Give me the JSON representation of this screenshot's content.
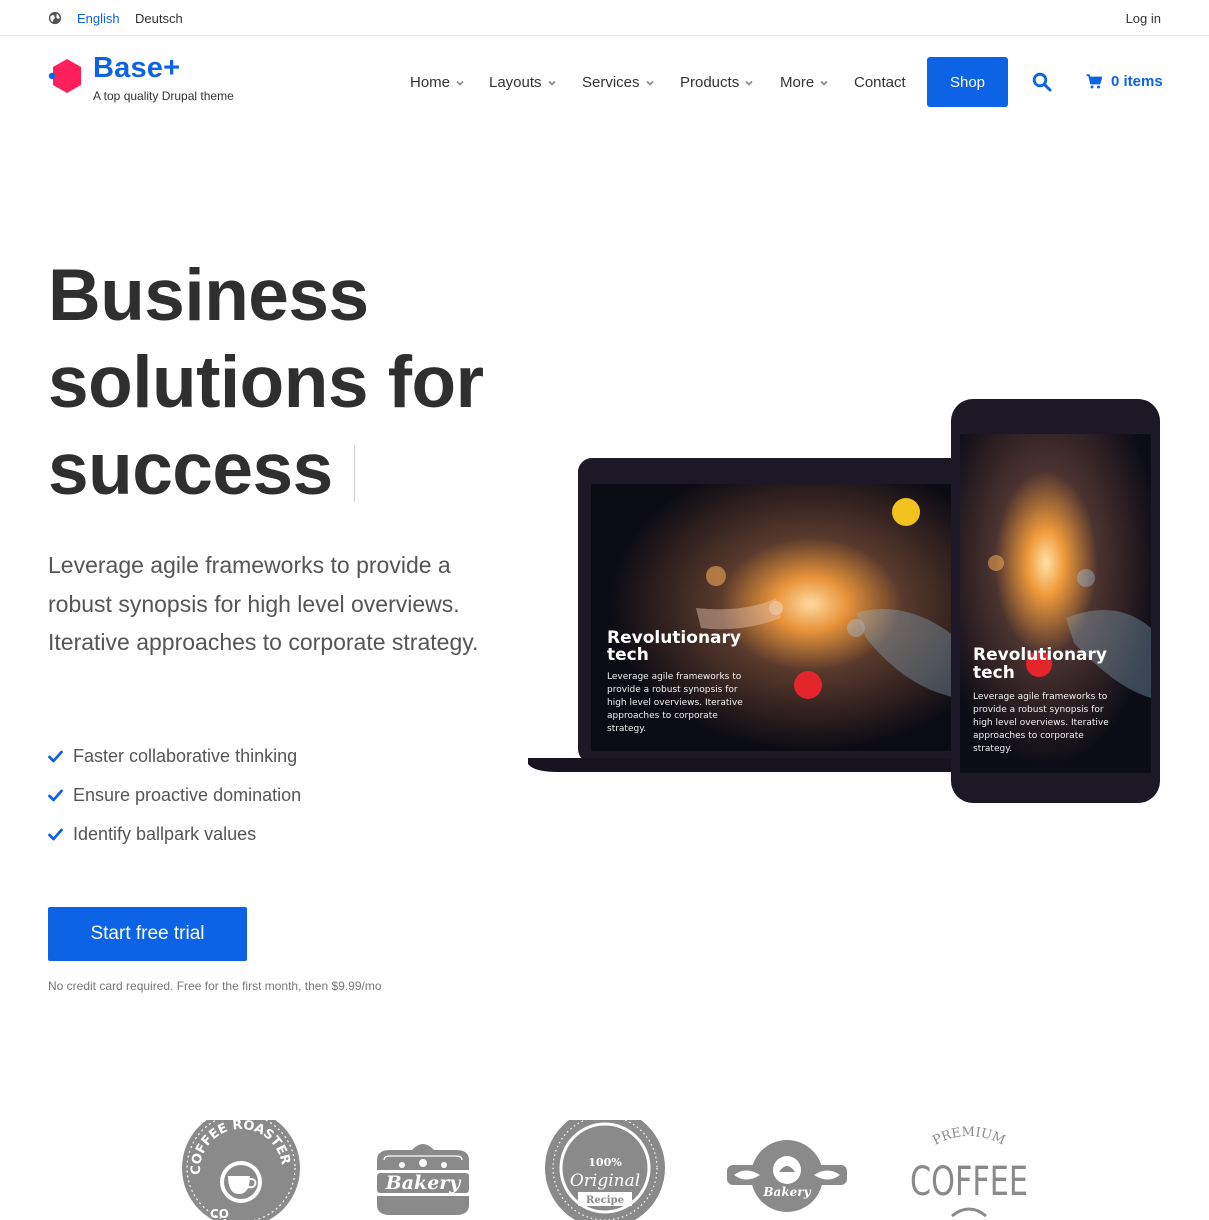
{
  "topbar": {
    "globe_icon": "globe-icon",
    "languages": [
      "English",
      "Deutsch"
    ],
    "active_language": "English",
    "login": "Log in"
  },
  "brand": {
    "name": "Base+",
    "slogan": "A top quality Drupal theme",
    "logo_colors": [
      "#ff1f5a",
      "#0d63e6"
    ]
  },
  "nav": {
    "items": [
      {
        "label": "Home",
        "dropdown": true
      },
      {
        "label": "Layouts",
        "dropdown": true
      },
      {
        "label": "Services",
        "dropdown": true
      },
      {
        "label": "Products",
        "dropdown": true
      },
      {
        "label": "More",
        "dropdown": true
      },
      {
        "label": "Contact",
        "dropdown": false
      }
    ],
    "shop": "Shop",
    "search_icon": "search-icon",
    "cart_icon": "cart-icon",
    "cart_label": "0 items"
  },
  "hero": {
    "title_lines": [
      "Business",
      "solutions for",
      "success"
    ],
    "text": "Leverage agile frameworks to provide a robust synopsis for high level overviews. Iterative approaches to corporate strategy.",
    "checks": [
      "Faster collaborative thinking",
      "Ensure proactive domination",
      "Identify ballpark values"
    ],
    "cta": "Start free trial",
    "cta_note": "No credit card required. Free for the first month, then $9.99/mo"
  },
  "devices": {
    "screen_title_lines": [
      "Revolutionary",
      "tech"
    ],
    "laptop_text_lines": [
      "Leverage agile frameworks to",
      "provide a robust synopsis for",
      "high level overviews. Iterative",
      "approaches to corporate",
      "strategy."
    ],
    "phone_text_lines": [
      "Leverage agile frameworks to",
      "provide a robust synopsis for",
      "high level overviews. Iterative",
      "approaches to corporate",
      "strategy."
    ]
  },
  "logos": {
    "coffee_roasters": {
      "arc_text": "COFFEE ROASTERS",
      "lower_text": "CO"
    },
    "bakery": {
      "text": "Bakery"
    },
    "original_recipe": {
      "line1": "100%",
      "line2": "Original",
      "line3": "Recipe"
    },
    "bakery_ribbon": {
      "text": "Bakery"
    },
    "premium_coffee": {
      "line1": "PREMIUM",
      "line2": "COFFEE"
    }
  },
  "colors": {
    "accent": "#0d63e6",
    "text_dark": "#2f2f2f",
    "text_muted": "#555555",
    "logo_gray": "#8a8a8a"
  }
}
